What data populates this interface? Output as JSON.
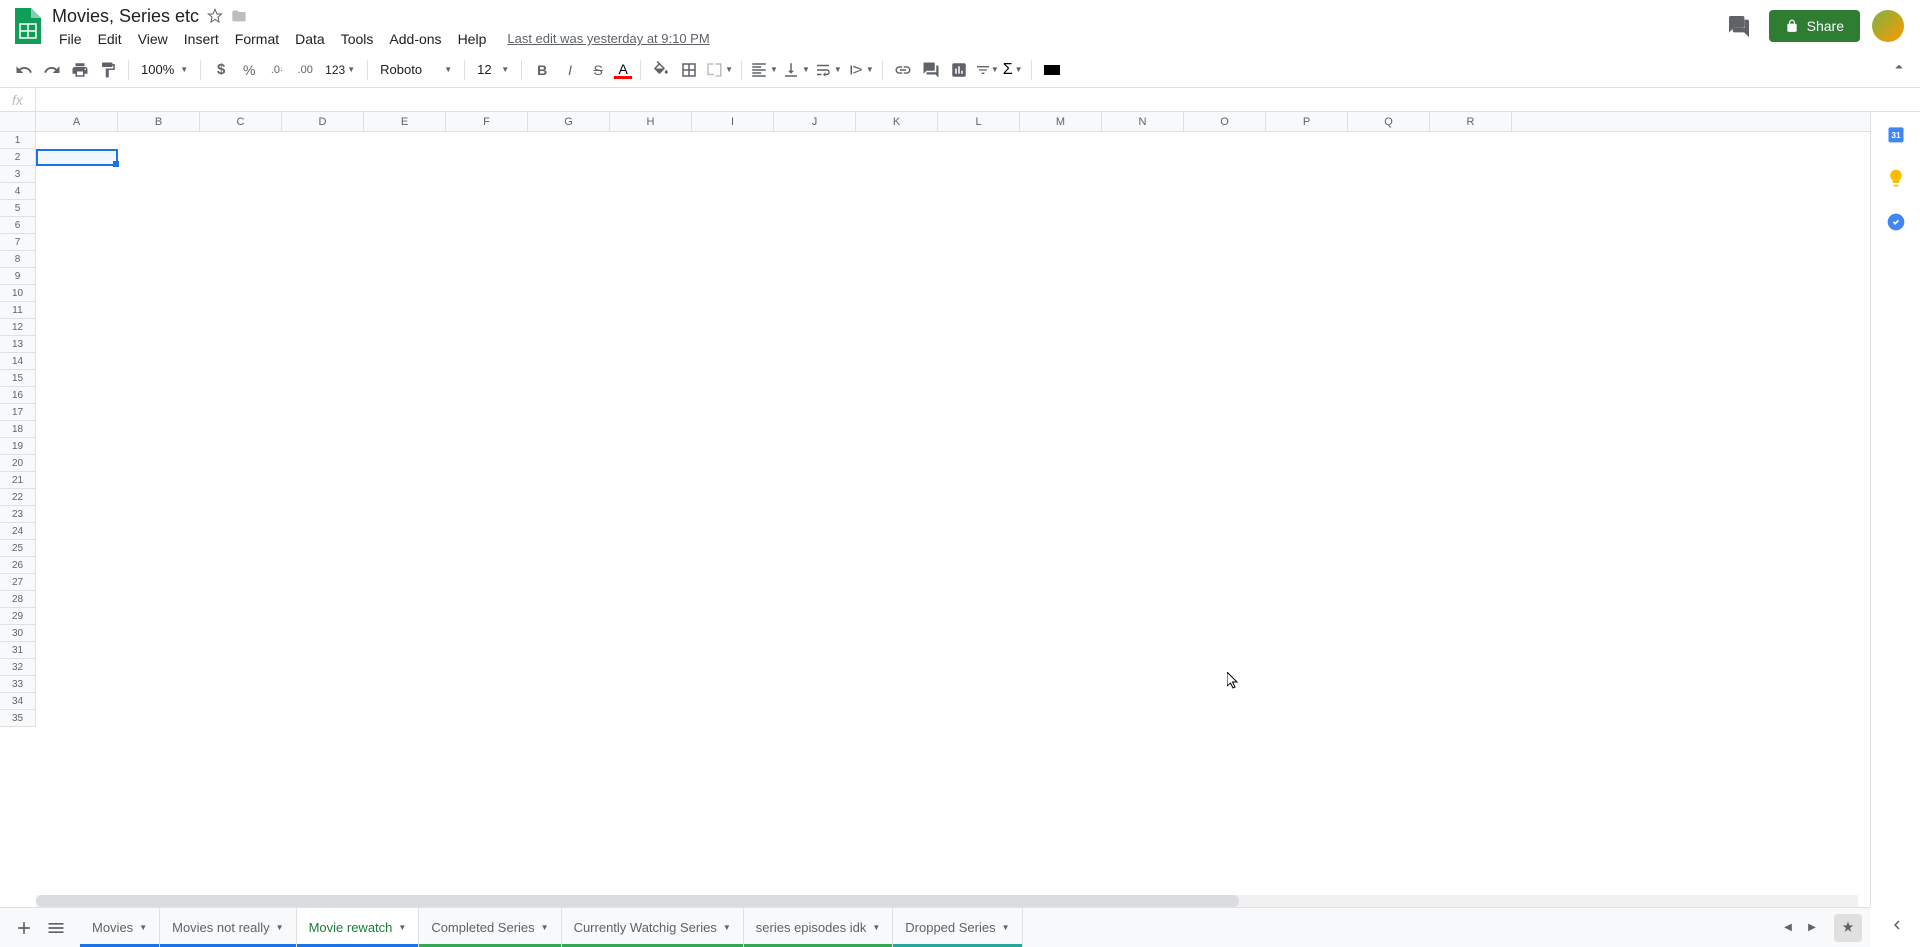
{
  "header": {
    "doc_title": "Movies, Series etc",
    "menus": [
      "File",
      "Edit",
      "View",
      "Insert",
      "Format",
      "Data",
      "Tools",
      "Add-ons",
      "Help"
    ],
    "last_edit": "Last edit was yesterday at 9:10 PM",
    "share_label": "Share"
  },
  "toolbar": {
    "zoom": "100%",
    "decimal_dec": ".0",
    "decimal_inc": ".00",
    "format_more": "123",
    "font": "Roboto",
    "font_size": "12",
    "text_color": "#ff0000",
    "fill_color": "#ffffff"
  },
  "formula_bar": {
    "fx": "fx",
    "value": ""
  },
  "grid": {
    "columns": [
      "A",
      "B",
      "C",
      "D",
      "E",
      "F",
      "G",
      "H",
      "I",
      "J",
      "K",
      "L",
      "M",
      "N",
      "O",
      "P",
      "Q",
      "R"
    ],
    "rows": [
      "1",
      "2",
      "3",
      "4",
      "5",
      "6",
      "7",
      "8",
      "9",
      "10",
      "11",
      "12",
      "13",
      "14",
      "15",
      "16",
      "17",
      "18",
      "19",
      "20",
      "21",
      "22",
      "23",
      "24",
      "25",
      "26",
      "27",
      "28",
      "29",
      "30",
      "31",
      "32",
      "33",
      "34",
      "35"
    ],
    "selected_cell": "A2"
  },
  "sheets": [
    {
      "name": "Movies",
      "color": "blue",
      "active": false
    },
    {
      "name": "Movies not really",
      "color": "blue",
      "active": false
    },
    {
      "name": "Movie rewatch",
      "color": "blue",
      "active": true
    },
    {
      "name": "Completed Series",
      "color": "green",
      "active": false
    },
    {
      "name": "Currently Watchig Series",
      "color": "green",
      "active": false
    },
    {
      "name": "series episodes idk",
      "color": "green",
      "active": false
    },
    {
      "name": "Dropped Series",
      "color": "teal",
      "active": false
    }
  ],
  "side_panel": {
    "icons": [
      "calendar",
      "keep",
      "tasks"
    ]
  }
}
